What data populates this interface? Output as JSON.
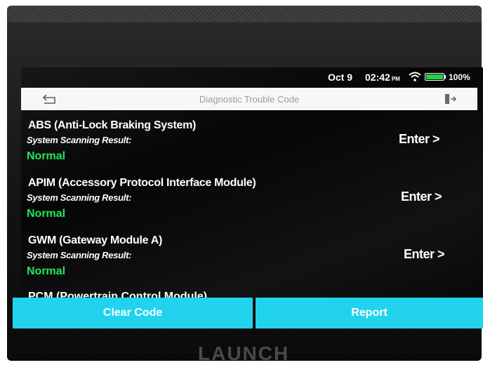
{
  "status": {
    "date": "Oct 9",
    "time": "02:42",
    "ampm": "PM",
    "battery": "100%",
    "battery_level": 1.0
  },
  "header": {
    "title": "Diagnostic Trouble Code",
    "back_icon": "back-arrow-icon",
    "exit_icon": "exit-icon"
  },
  "systems": [
    {
      "name": "ABS (Anti-Lock Braking System)",
      "scan_label": "System Scanning Result:",
      "result": "Normal",
      "enter_label": "Enter >"
    },
    {
      "name": "APIM (Accessory Protocol Interface Module)",
      "scan_label": "System Scanning Result:",
      "result": "Normal",
      "enter_label": "Enter >"
    },
    {
      "name": "GWM (Gateway Module A)",
      "scan_label": "System Scanning Result:",
      "result": "Normal",
      "enter_label": "Enter >"
    }
  ],
  "partial_system_name": "PCM (Powertrain Control Module)",
  "actions": {
    "clear_code": "Clear Code",
    "report": "Report"
  },
  "brand": "LAUNCH",
  "colors": {
    "accent": "#22d3ee",
    "normal_status": "#1ee856",
    "battery": "#23d14a"
  }
}
